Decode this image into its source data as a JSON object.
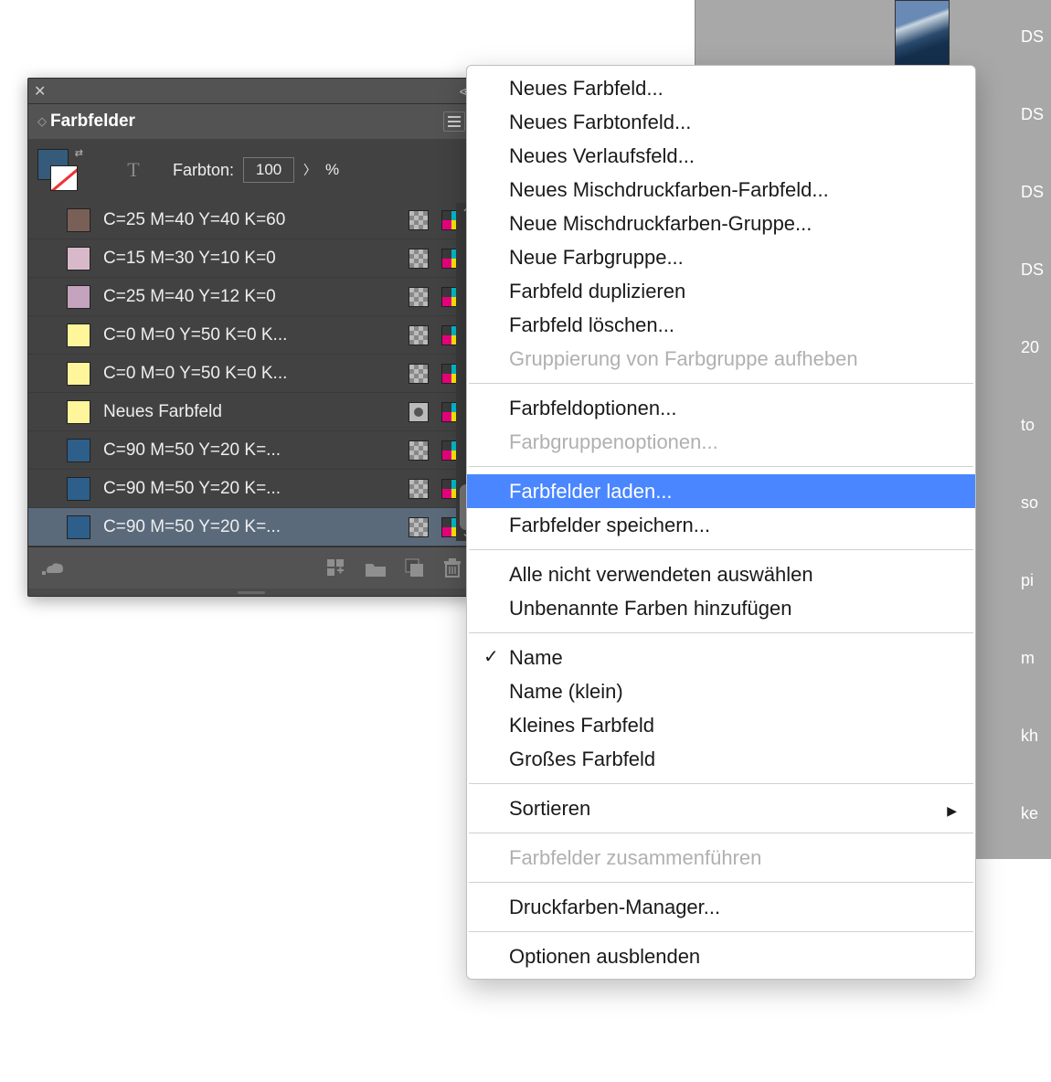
{
  "panel": {
    "title": "Farbfelder",
    "controls": {
      "tone_label": "Farbton:",
      "tone_value": "100",
      "tone_unit": "%"
    },
    "swatches": [
      {
        "name": "C=25 M=40 Y=40 K=60",
        "color": "#7a5f56",
        "type": "process",
        "selected": false
      },
      {
        "name": "C=15 M=30 Y=10 K=0",
        "color": "#d8b9c9",
        "type": "process",
        "selected": false
      },
      {
        "name": "C=25 M=40 Y=12 K=0",
        "color": "#c3a3bd",
        "type": "process",
        "selected": false
      },
      {
        "name": "C=0 M=0 Y=50 K=0 K...",
        "color": "#fff59b",
        "type": "process",
        "selected": false
      },
      {
        "name": "C=0 M=0 Y=50 K=0 K...",
        "color": "#fff59b",
        "type": "process",
        "selected": false
      },
      {
        "name": "Neues Farbfeld",
        "color": "#fff59b",
        "type": "spot",
        "selected": false
      },
      {
        "name": "C=90 M=50 Y=20 K=...",
        "color": "#2d5f8a",
        "type": "process",
        "selected": false
      },
      {
        "name": "C=90 M=50 Y=20 K=...",
        "color": "#2d5f8a",
        "type": "process",
        "selected": false
      },
      {
        "name": "C=90 M=50 Y=20 K=...",
        "color": "#2d5f8a",
        "type": "process",
        "selected": true
      }
    ]
  },
  "context_menu": {
    "groups": [
      [
        {
          "label": "Neues Farbfeld...",
          "enabled": true
        },
        {
          "label": "Neues Farbtonfeld...",
          "enabled": true
        },
        {
          "label": "Neues Verlaufsfeld...",
          "enabled": true
        },
        {
          "label": "Neues Mischdruckfarben-Farbfeld...",
          "enabled": true
        },
        {
          "label": "Neue Mischdruckfarben-Gruppe...",
          "enabled": true
        },
        {
          "label": "Neue Farbgruppe...",
          "enabled": true
        },
        {
          "label": "Farbfeld duplizieren",
          "enabled": true
        },
        {
          "label": "Farbfeld löschen...",
          "enabled": true
        },
        {
          "label": "Gruppierung von Farbgruppe aufheben",
          "enabled": false
        }
      ],
      [
        {
          "label": "Farbfeldoptionen...",
          "enabled": true
        },
        {
          "label": "Farbgruppenoptionen...",
          "enabled": false
        }
      ],
      [
        {
          "label": "Farbfelder laden...",
          "enabled": true,
          "highlight": true
        },
        {
          "label": "Farbfelder speichern...",
          "enabled": true
        }
      ],
      [
        {
          "label": "Alle nicht verwendeten auswählen",
          "enabled": true
        },
        {
          "label": "Unbenannte Farben hinzufügen",
          "enabled": true
        }
      ],
      [
        {
          "label": "Name",
          "enabled": true,
          "checked": true
        },
        {
          "label": "Name (klein)",
          "enabled": true
        },
        {
          "label": "Kleines Farbfeld",
          "enabled": true
        },
        {
          "label": "Großes Farbfeld",
          "enabled": true
        }
      ],
      [
        {
          "label": "Sortieren",
          "enabled": true,
          "submenu": true
        }
      ],
      [
        {
          "label": "Farbfelder zusammenführen",
          "enabled": false
        }
      ],
      [
        {
          "label": "Druckfarben-Manager...",
          "enabled": true
        }
      ],
      [
        {
          "label": "Optionen ausblenden",
          "enabled": true
        }
      ]
    ]
  },
  "right_sidebar": {
    "labels": [
      "DS",
      "DS",
      "DS",
      "DS",
      "20",
      "to",
      "so",
      "pi",
      "m",
      "kh",
      "ke"
    ]
  }
}
